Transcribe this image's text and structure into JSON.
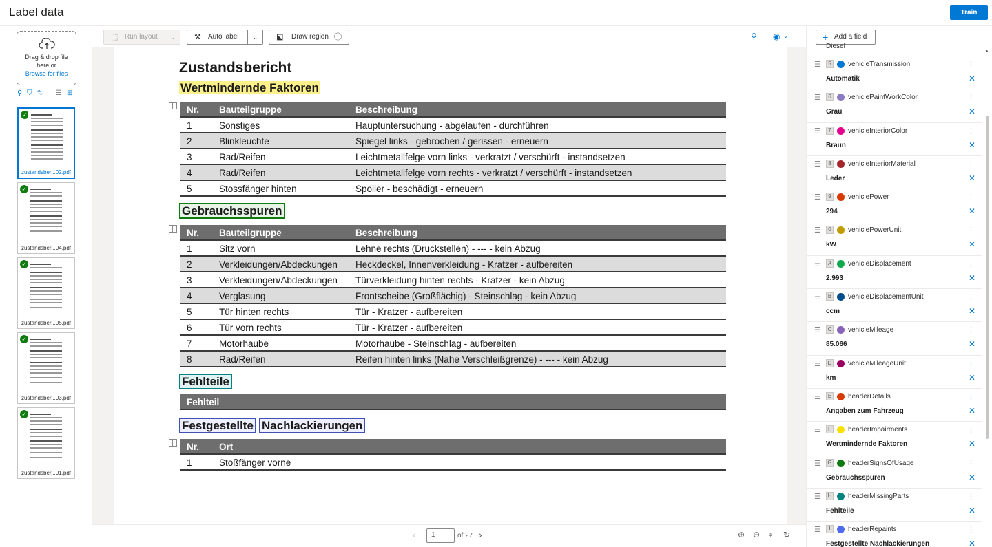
{
  "app": {
    "title": "Label data",
    "train_label": "Train"
  },
  "left": {
    "dropzone": {
      "line1": "Drag & drop file",
      "line2": "here or",
      "browse": "Browse for files"
    },
    "thumbnails": [
      {
        "name": "zustandsber...02.pdf",
        "selected": true
      },
      {
        "name": "zustandsber...04.pdf",
        "selected": false
      },
      {
        "name": "zustandsber...05.pdf",
        "selected": false
      },
      {
        "name": "zustandsber...03.pdf",
        "selected": false
      },
      {
        "name": "zustandsber...01.pdf",
        "selected": false
      }
    ]
  },
  "toolbar": {
    "run_layout": "Run layout",
    "auto_label": "Auto label",
    "draw_region": "Draw region"
  },
  "document": {
    "title": "Zustandsbericht",
    "section1": "Wertmindernde Faktoren",
    "table1": {
      "headers": [
        "Nr.",
        "Bauteilgruppe",
        "Beschreibung"
      ],
      "rows": [
        [
          "1",
          "Sonstiges",
          "Hauptuntersuchung - abgelaufen - durchführen"
        ],
        [
          "2",
          "Blinkleuchte",
          "Spiegel links - gebrochen / gerissen - erneuern"
        ],
        [
          "3",
          "Rad/Reifen",
          "Leichtmetallfelge vorn links - verkratzt / verschürft - instandsetzen"
        ],
        [
          "4",
          "Rad/Reifen",
          "Leichtmetallfelge vorn rechts - verkratzt / verschürft - instandsetzen"
        ],
        [
          "5",
          "Stossfänger hinten",
          "Spoiler - beschädigt - erneuern"
        ]
      ]
    },
    "section2": "Gebrauchsspuren",
    "table2": {
      "headers": [
        "Nr.",
        "Bauteilgruppe",
        "Beschreibung"
      ],
      "rows": [
        [
          "1",
          "Sitz vorn",
          "Lehne rechts (Druckstellen) - --- - kein Abzug"
        ],
        [
          "2",
          "Verkleidungen/Abdeckungen",
          "Heckdeckel, Innenverkleidung - Kratzer - aufbereiten"
        ],
        [
          "3",
          "Verkleidungen/Abdeckungen",
          "Türverkleidung hinten rechts - Kratzer - kein Abzug"
        ],
        [
          "4",
          "Verglasung",
          "Frontscheibe (Großflächig) - Steinschlag - kein Abzug"
        ],
        [
          "5",
          "Tür hinten rechts",
          "Tür - Kratzer - aufbereiten"
        ],
        [
          "6",
          "Tür vorn rechts",
          "Tür - Kratzer - aufbereiten"
        ],
        [
          "7",
          "Motorhaube",
          "Motorhaube - Steinschlag - aufbereiten"
        ],
        [
          "8",
          "Rad/Reifen",
          "Reifen hinten links (Nahe Verschleißgrenze) - --- - kein Abzug"
        ]
      ]
    },
    "section3": "Fehlteile",
    "table3_header": "Fehlteil",
    "section4a": "Festgestellte",
    "section4b": "Nachlackierungen",
    "table4": {
      "headers": [
        "Nr.",
        "Ort"
      ],
      "rows": [
        [
          "1",
          "Stoßfänger vorne"
        ]
      ]
    }
  },
  "pager": {
    "page": "1",
    "of": "of 27"
  },
  "fields_panel": {
    "add_field": "Add a field",
    "cut_text": "Diesel",
    "fields": [
      {
        "key": "5",
        "name": "vehicleTransmission",
        "color": "#0078d4",
        "value": "Automatik"
      },
      {
        "key": "6",
        "name": "vehiclePaintWorkColor",
        "color": "#8e7cc3",
        "value": "Grau"
      },
      {
        "key": "7",
        "name": "vehicleInteriorColor",
        "color": "#e3008c",
        "value": "Braun"
      },
      {
        "key": "8",
        "name": "vehicleInteriorMaterial",
        "color": "#a4262c",
        "value": "Leder"
      },
      {
        "key": "9",
        "name": "vehiclePower",
        "color": "#d83b01",
        "value": "294"
      },
      {
        "key": "0",
        "name": "vehiclePowerUnit",
        "color": "#c19c00",
        "value": "kW"
      },
      {
        "key": "A",
        "name": "vehicleDisplacement",
        "color": "#10a84e",
        "value": "2.993"
      },
      {
        "key": "B",
        "name": "vehicleDisplacementUnit",
        "color": "#004e8c",
        "value": "ccm"
      },
      {
        "key": "C",
        "name": "vehicleMileage",
        "color": "#8764b8",
        "value": "85.066"
      },
      {
        "key": "D",
        "name": "vehicleMileageUnit",
        "color": "#9b0062",
        "value": "km"
      },
      {
        "key": "E",
        "name": "headerDetails",
        "color": "#d83b01",
        "value": "Angaben zum Fahrzeug"
      },
      {
        "key": "F",
        "name": "headerImpairments",
        "color": "#fce100",
        "value": "Wertmindernde Faktoren"
      },
      {
        "key": "G",
        "name": "headerSignsOfUsage",
        "color": "#107c10",
        "value": "Gebrauchsspuren"
      },
      {
        "key": "H",
        "name": "headerMissingParts",
        "color": "#00827f",
        "value": "Fehlteile"
      },
      {
        "key": "I",
        "name": "headerRepaints",
        "color": "#4f6bed",
        "value": "Festgestellte Nachlackierungen"
      }
    ]
  }
}
